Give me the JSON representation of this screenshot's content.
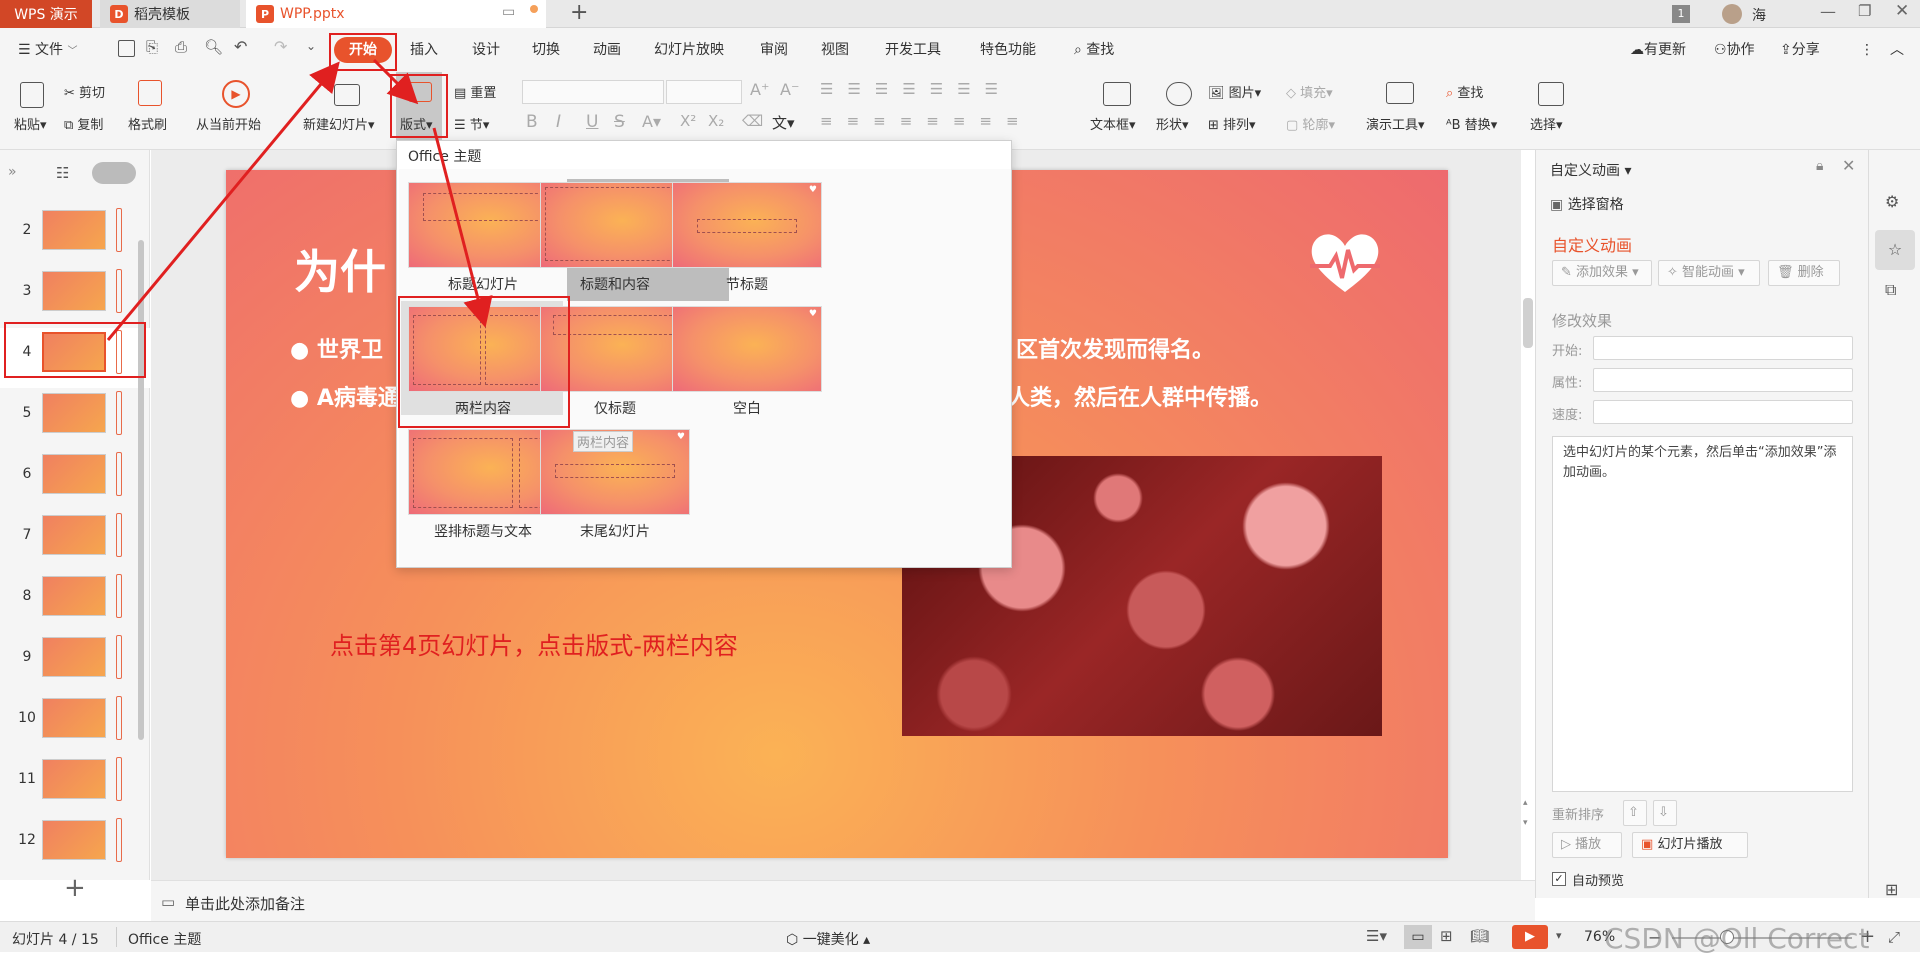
{
  "tabs": {
    "wps": "WPS 演示",
    "daoke": "稻壳模板",
    "file": "WPP.pptx",
    "page_badge": "1",
    "user": "海"
  },
  "menu": {
    "file": "文件",
    "start": "开始",
    "items": [
      "插入",
      "设计",
      "切换",
      "动画",
      "幻灯片放映",
      "审阅",
      "视图",
      "开发工具",
      "特色功能"
    ],
    "search": "查找",
    "update": "有更新",
    "collab": "协作",
    "share": "分享"
  },
  "ribbon": {
    "paste": "粘贴",
    "cut": "剪切",
    "copy": "复制",
    "format_painter": "格式刷",
    "from_current": "从当前开始",
    "new_slide": "新建幻灯片",
    "layout": "版式",
    "reset": "重置",
    "section": "节",
    "text": "文",
    "textbox": "文本框",
    "shape": "形状",
    "picture": "图片",
    "fill": "填充",
    "arrange": "排列",
    "outline": "轮廓",
    "presenter": "演示工具",
    "find": "查找",
    "replace": "替换",
    "select": "选择"
  },
  "dropdown": {
    "header": "Office 主题",
    "layouts": [
      "标题幻灯片",
      "标题和内容",
      "节标题",
      "两栏内容",
      "仅标题",
      "空白",
      "竖排标题与文本",
      "末尾幻灯片"
    ],
    "tooltip": "两栏内容"
  },
  "thumbnails": [
    "2",
    "3",
    "4",
    "5",
    "6",
    "7",
    "8",
    "9",
    "10",
    "11",
    "12"
  ],
  "slide": {
    "title": "为什",
    "bullet1_left": "世界卫",
    "bullet1_right": "区首次发现而得名。",
    "bullet2_left": "A病毒通",
    "bullet2_right": "人类，然后在人群中传播。",
    "instruction": "点击第4页幻灯片，点击版式-两栏内容"
  },
  "rightpanel": {
    "title": "自定义动画",
    "select_pane": "选择窗格",
    "section_title": "自定义动画",
    "add_effect": "添加效果",
    "smart_anim": "智能动画",
    "delete": "删除",
    "modify": "修改效果",
    "start": "开始:",
    "property": "属性:",
    "speed": "速度:",
    "hint": "选中幻灯片的某个元素，然后单击“添加效果”添加动画。",
    "reorder": "重新排序",
    "play": "播放",
    "slideshow": "幻灯片播放",
    "auto_preview": "自动预览"
  },
  "notes": "单击此处添加备注",
  "status": {
    "slide_count": "幻灯片 4 / 15",
    "theme": "Office 主题",
    "beautify": "一键美化",
    "zoom": "76%",
    "watermark": "CSDN @Oll Correct"
  },
  "colors": {
    "accent": "#e8532c",
    "annotation_red": "#e02020",
    "wps_red": "#d24726"
  }
}
